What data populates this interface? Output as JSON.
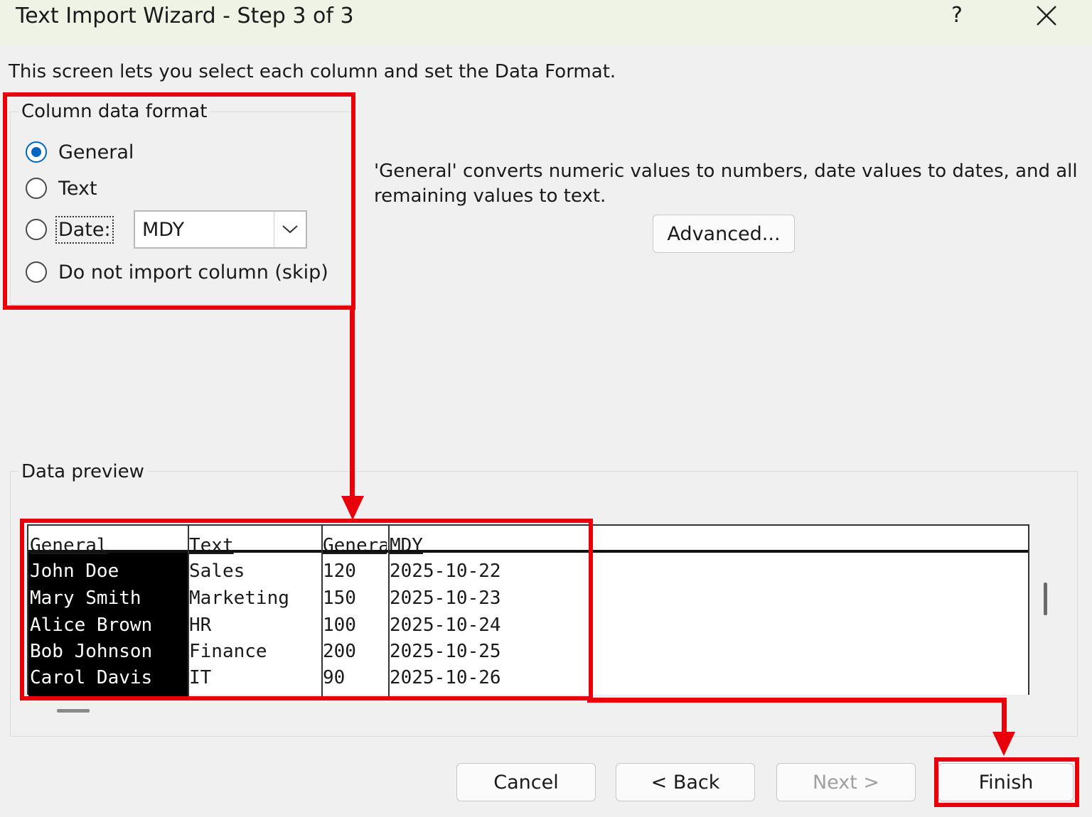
{
  "window": {
    "title": "Text Import Wizard - Step 3 of 3",
    "help_label": "?",
    "close_icon": "close-icon"
  },
  "intro_text": "This screen lets you select each column and set the Data Format.",
  "column_format": {
    "group_label": "Column data format",
    "options": [
      {
        "label": "General",
        "checked": true
      },
      {
        "label": "Text",
        "checked": false
      },
      {
        "label": "Date:",
        "checked": false
      },
      {
        "label": "Do not import column (skip)",
        "checked": false
      }
    ],
    "date_format": "MDY"
  },
  "description": "'General' converts numeric values to numbers, date values to dates, and all remaining values to text.",
  "advanced_button": "Advanced...",
  "preview": {
    "group_label": "Data preview",
    "headers": [
      "General",
      "Text",
      "General",
      "MDY"
    ],
    "rows": [
      [
        "John Doe",
        "Sales",
        "120",
        "2025-10-22"
      ],
      [
        "Mary Smith",
        "Marketing",
        "150",
        "2025-10-23"
      ],
      [
        "Alice Brown",
        "HR",
        "100",
        "2025-10-24"
      ],
      [
        "Bob Johnson",
        "Finance",
        "200",
        "2025-10-25"
      ],
      [
        "Carol Davis",
        "IT",
        "90",
        "2025-10-26"
      ]
    ]
  },
  "buttons": {
    "cancel": "Cancel",
    "back": "< Back",
    "next": "Next >",
    "finish": "Finish"
  },
  "colors": {
    "annotation_red": "#e8000b",
    "accent_blue": "#0067c0",
    "titlebar": "#eef3e6"
  }
}
